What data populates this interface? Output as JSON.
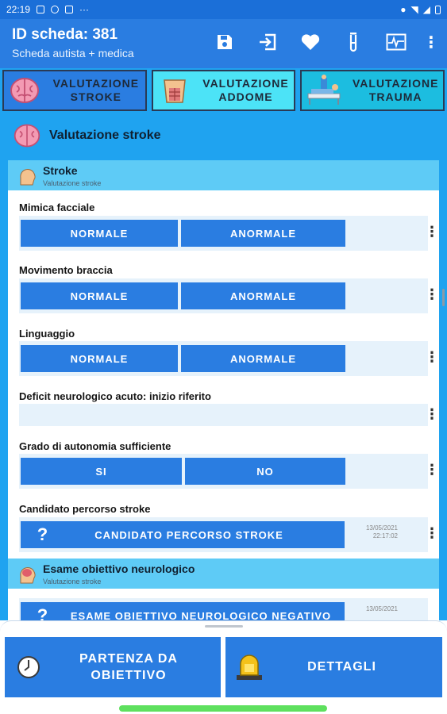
{
  "status": {
    "time": "22:19",
    "extra": "···"
  },
  "header": {
    "title": "ID scheda: 381",
    "subtitle": "Scheda autista + medica"
  },
  "tabs": [
    {
      "label": "VALUTAZIONE\nSTROKE"
    },
    {
      "label": "VALUTAZIONE\nADDOME"
    },
    {
      "label": "VALUTAZIONE\nTRAUMA"
    }
  ],
  "section": {
    "title": "Valutazione stroke"
  },
  "group_stroke": {
    "title": "Stroke",
    "subtitle": "Valutazione stroke"
  },
  "questions": {
    "mimica": {
      "label": "Mimica facciale",
      "opt1": "NORMALE",
      "opt2": "ANORMALE"
    },
    "braccia": {
      "label": "Movimento braccia",
      "opt1": "NORMALE",
      "opt2": "ANORMALE"
    },
    "linguaggio": {
      "label": "Linguaggio",
      "opt1": "NORMALE",
      "opt2": "ANORMALE"
    },
    "deficit": {
      "label": "Deficit neurologico acuto: inizio riferito",
      "value": ""
    },
    "autonomia": {
      "label": "Grado di autonomia sufficiente",
      "opt1": "SI",
      "opt2": "NO"
    },
    "candidato": {
      "label": "Candidato percorso stroke",
      "button": "CANDIDATO PERCORSO STROKE",
      "date": "13/05/2021",
      "time": "22:17:02"
    }
  },
  "group_esame": {
    "title": "Esame obiettivo neurologico",
    "subtitle": "Valutazione stroke"
  },
  "esame": {
    "button": "ESAME OBIETTIVO NEUROLOGICO NEGATIVO",
    "date": "13/05/2021"
  },
  "bottom": {
    "partenza": "PARTENZA DA\nOBIETTIVO",
    "dettagli": "DETTAGLI"
  },
  "colors": {
    "primary": "#2a7de1",
    "accent": "#1fa3f0",
    "band": "#5ecbf6",
    "selected_tab": "#4ce3f7"
  }
}
